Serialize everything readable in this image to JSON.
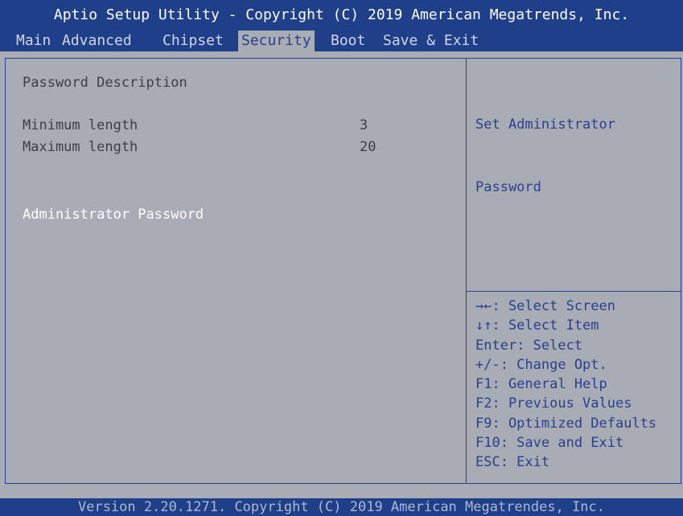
{
  "header": {
    "title": "Aptio Setup Utility - Copyright (C) 2019 American Megatrends, Inc."
  },
  "menu": {
    "tabs": [
      {
        "label": "Main"
      },
      {
        "label": "Advanced"
      },
      {
        "label": "Chipset"
      },
      {
        "label": "Security"
      },
      {
        "label": "Boot"
      },
      {
        "label": "Save & Exit"
      }
    ],
    "active": "Security"
  },
  "content": {
    "section_title": "Password Description",
    "min_label": "Minimum length",
    "min_value": "3",
    "max_label": "Maximum length",
    "max_value": "20",
    "admin_password_label": "Administrator Password"
  },
  "help": {
    "line1": "Set Administrator",
    "line2": "Password"
  },
  "keys": [
    "→←: Select Screen",
    "↓↑: Select Item",
    "Enter: Select",
    "+/-: Change Opt.",
    "F1: General Help",
    "F2: Previous Values",
    "F9: Optimized Defaults",
    "F10: Save and Exit",
    "ESC: Exit"
  ],
  "footer": {
    "text": "Version 2.20.1271. Copyright (C) 2019 American Megatrendes, Inc."
  },
  "colors": {
    "header_bg": "#1f3f88",
    "body_bg": "#a8acb4",
    "accent_blue": "#2a3f8e",
    "selected_text": "#ffffff"
  }
}
